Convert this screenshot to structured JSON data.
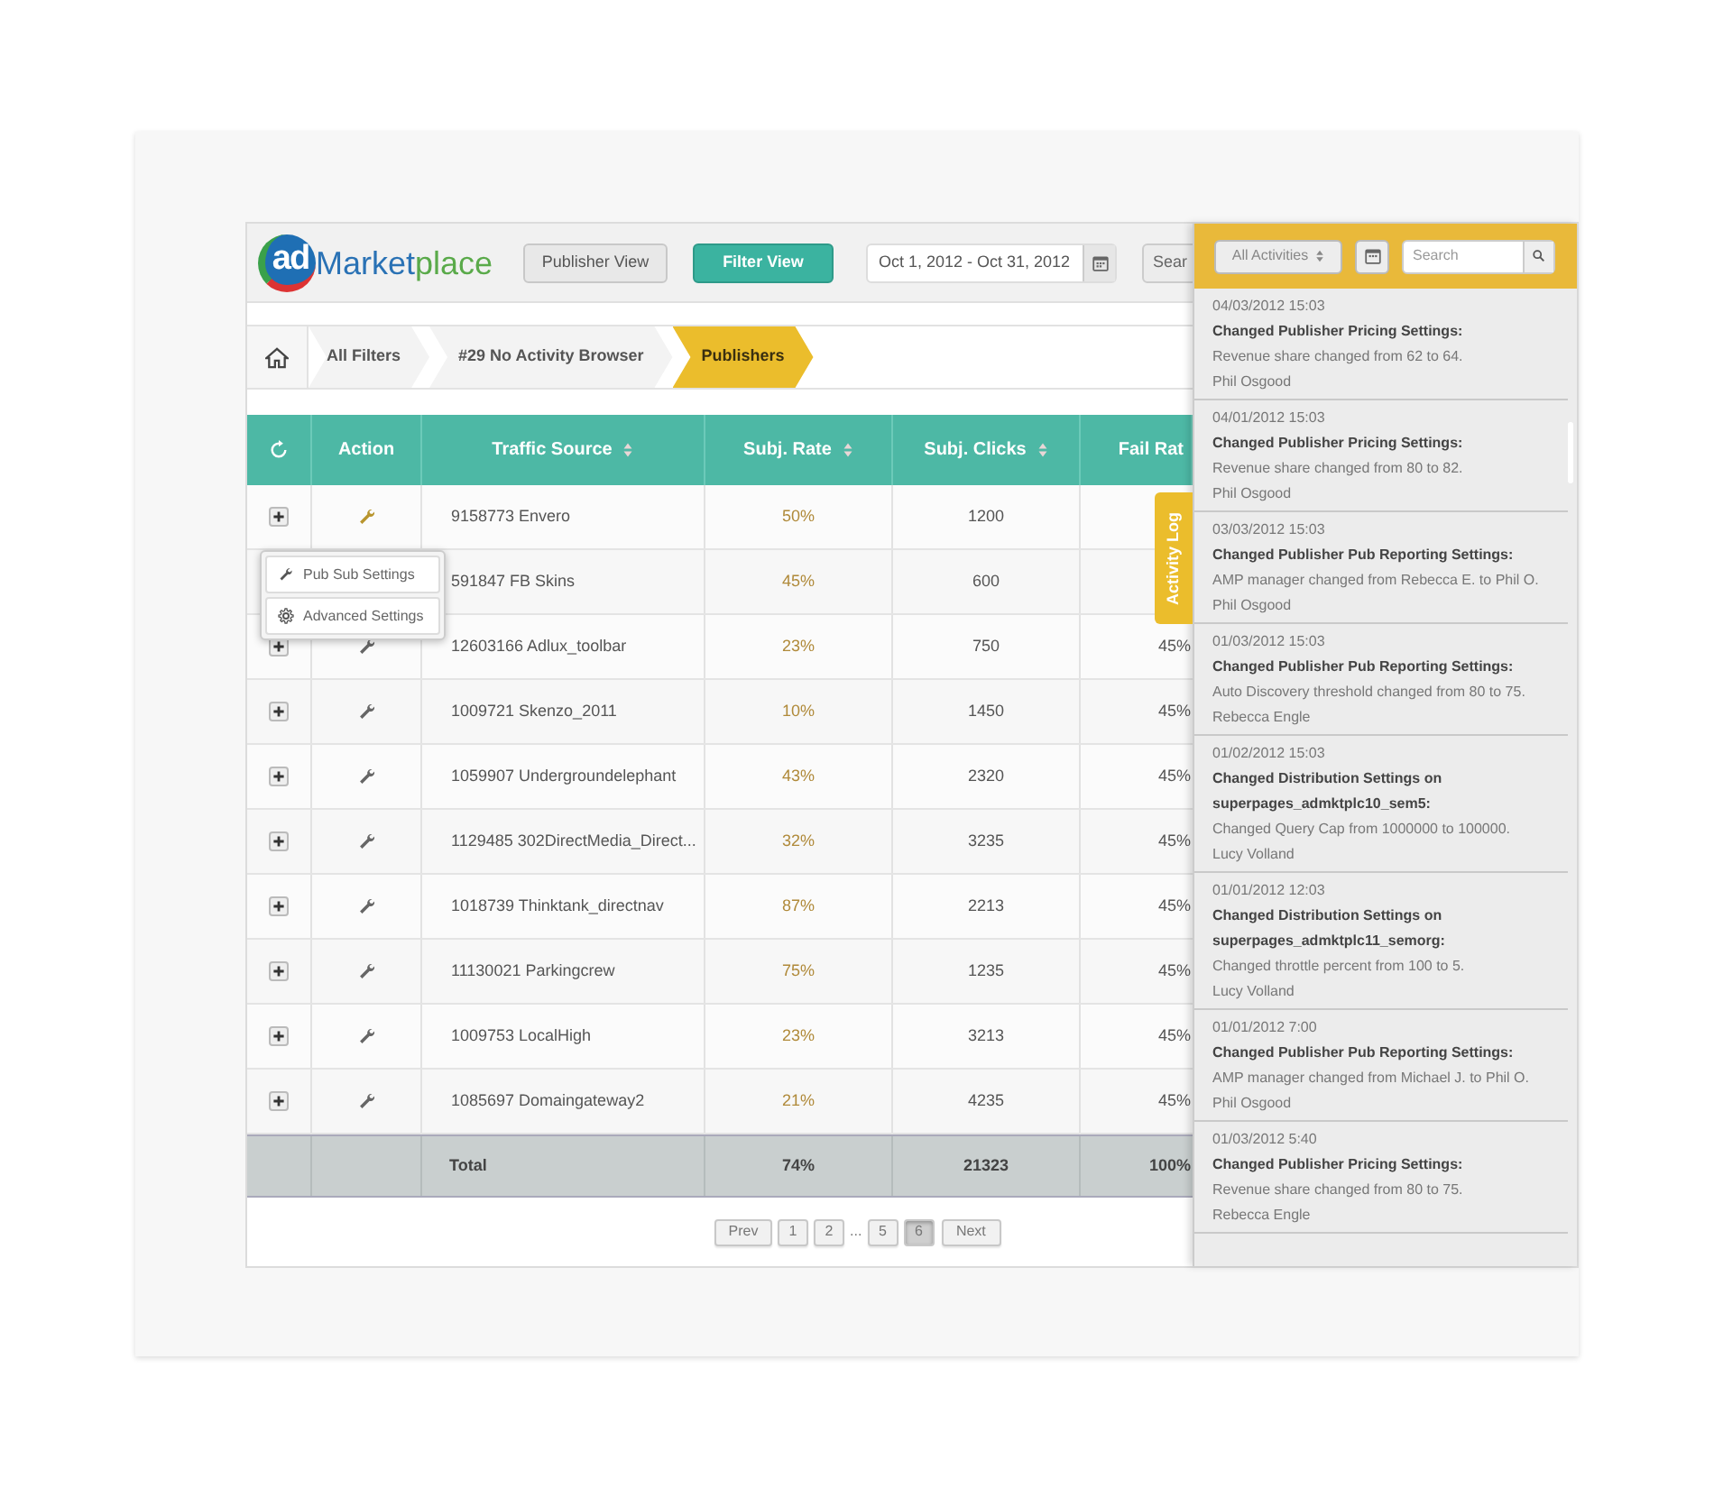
{
  "header": {
    "logo": {
      "badge": "ad",
      "words": [
        "Market",
        "place"
      ]
    },
    "views": [
      {
        "label": "Publisher View",
        "selected": false
      },
      {
        "label": "Filter View",
        "selected": true
      }
    ],
    "date_range": "Oct 1, 2012 - Oct 31, 2012",
    "search_button": "Sear"
  },
  "breadcrumb": [
    {
      "label": "All Filters",
      "selected": false
    },
    {
      "label": "#29 No Activity Browser",
      "selected": false
    },
    {
      "label": "Publishers",
      "selected": true
    }
  ],
  "table": {
    "columns": [
      "Action",
      "Traffic Source",
      "Subj. Rate",
      "Subj. Clicks",
      "Fail Rat"
    ],
    "rows": [
      {
        "active": true,
        "source": "9158773 Envero",
        "rate": "50%",
        "clicks": "1200",
        "fail": ""
      },
      {
        "active": false,
        "source": "591847 FB Skins",
        "rate": "45%",
        "clicks": "600",
        "fail": ""
      },
      {
        "active": false,
        "source": "12603166 Adlux_toolbar",
        "rate": "23%",
        "clicks": "750",
        "fail": "45%"
      },
      {
        "active": false,
        "source": "1009721 Skenzo_2011",
        "rate": "10%",
        "clicks": "1450",
        "fail": "45%"
      },
      {
        "active": false,
        "source": "1059907 Undergroundelephant",
        "rate": "43%",
        "clicks": "2320",
        "fail": "45%"
      },
      {
        "active": false,
        "source": "1129485 302DirectMedia_Direct...",
        "rate": "32%",
        "clicks": "3235",
        "fail": "45%"
      },
      {
        "active": false,
        "source": "1018739 Thinktank_directnav",
        "rate": "87%",
        "clicks": "2213",
        "fail": "45%"
      },
      {
        "active": false,
        "source": "11130021 Parkingcrew",
        "rate": "75%",
        "clicks": "1235",
        "fail": "45%"
      },
      {
        "active": false,
        "source": "1009753 LocalHigh",
        "rate": "23%",
        "clicks": "3213",
        "fail": "45%"
      },
      {
        "active": false,
        "source": "1085697 Domaingateway2",
        "rate": "21%",
        "clicks": "4235",
        "fail": "45%"
      }
    ],
    "total": {
      "label": "Total",
      "rate": "74%",
      "clicks": "21323",
      "fail": "100%"
    }
  },
  "action_menu": [
    {
      "kind": "wrench",
      "label": "Pub Sub Settings"
    },
    {
      "kind": "gear",
      "label": "Advanced Settings"
    }
  ],
  "activity_tab": "Activity Log",
  "pagination": {
    "prev": "Prev",
    "pages": [
      {
        "label": "1",
        "selected": false
      },
      {
        "label": "2",
        "selected": false
      },
      {
        "label": "...",
        "kind": "gap"
      },
      {
        "label": "5",
        "selected": false
      },
      {
        "label": "6",
        "selected": true
      }
    ],
    "next": "Next"
  },
  "activity_panel": {
    "filter": "All Activities",
    "search_placeholder": "Search",
    "entries": [
      {
        "time": "04/03/2012 15:03",
        "title": "Changed Publisher Pricing Settings:",
        "detail": "Revenue share changed from 62 to 64.",
        "user": "Phil Osgood"
      },
      {
        "time": "04/01/2012 15:03",
        "title": "Changed Publisher Pricing Settings:",
        "detail": "Revenue share changed from 80 to 82.",
        "user": "Phil Osgood"
      },
      {
        "time": "03/03/2012 15:03",
        "title": "Changed Publisher Pub Reporting Settings:",
        "detail": "AMP manager changed from Rebecca E. to Phil O.",
        "user": "Phil Osgood"
      },
      {
        "time": "01/03/2012 15:03",
        "title": "Changed Publisher Pub Reporting Settings:",
        "detail": "Auto Discovery threshold changed from 80 to 75.",
        "user": "Rebecca Engle"
      },
      {
        "time": "01/02/2012 15:03",
        "title": "Changed Distribution Settings on superpages_admktplc10_sem5:",
        "detail": "Changed Query Cap from 1000000 to 100000.",
        "user": "Lucy Volland"
      },
      {
        "time": "01/01/2012 12:03",
        "title": "Changed Distribution Settings on superpages_admktplc11_semorg:",
        "detail": "Changed throttle percent from 100 to 5.",
        "user": "Lucy Volland"
      },
      {
        "time": "01/01/2012 7:00",
        "title": "Changed Publisher Pub Reporting Settings:",
        "detail": "AMP manager changed from Michael J. to Phil O.",
        "user": "Phil Osgood"
      },
      {
        "time": "01/03/2012 5:40",
        "title": "Changed Publisher Pricing Settings:",
        "detail": "Revenue share changed from 80 to 75.",
        "user": "Rebecca Engle"
      }
    ]
  }
}
